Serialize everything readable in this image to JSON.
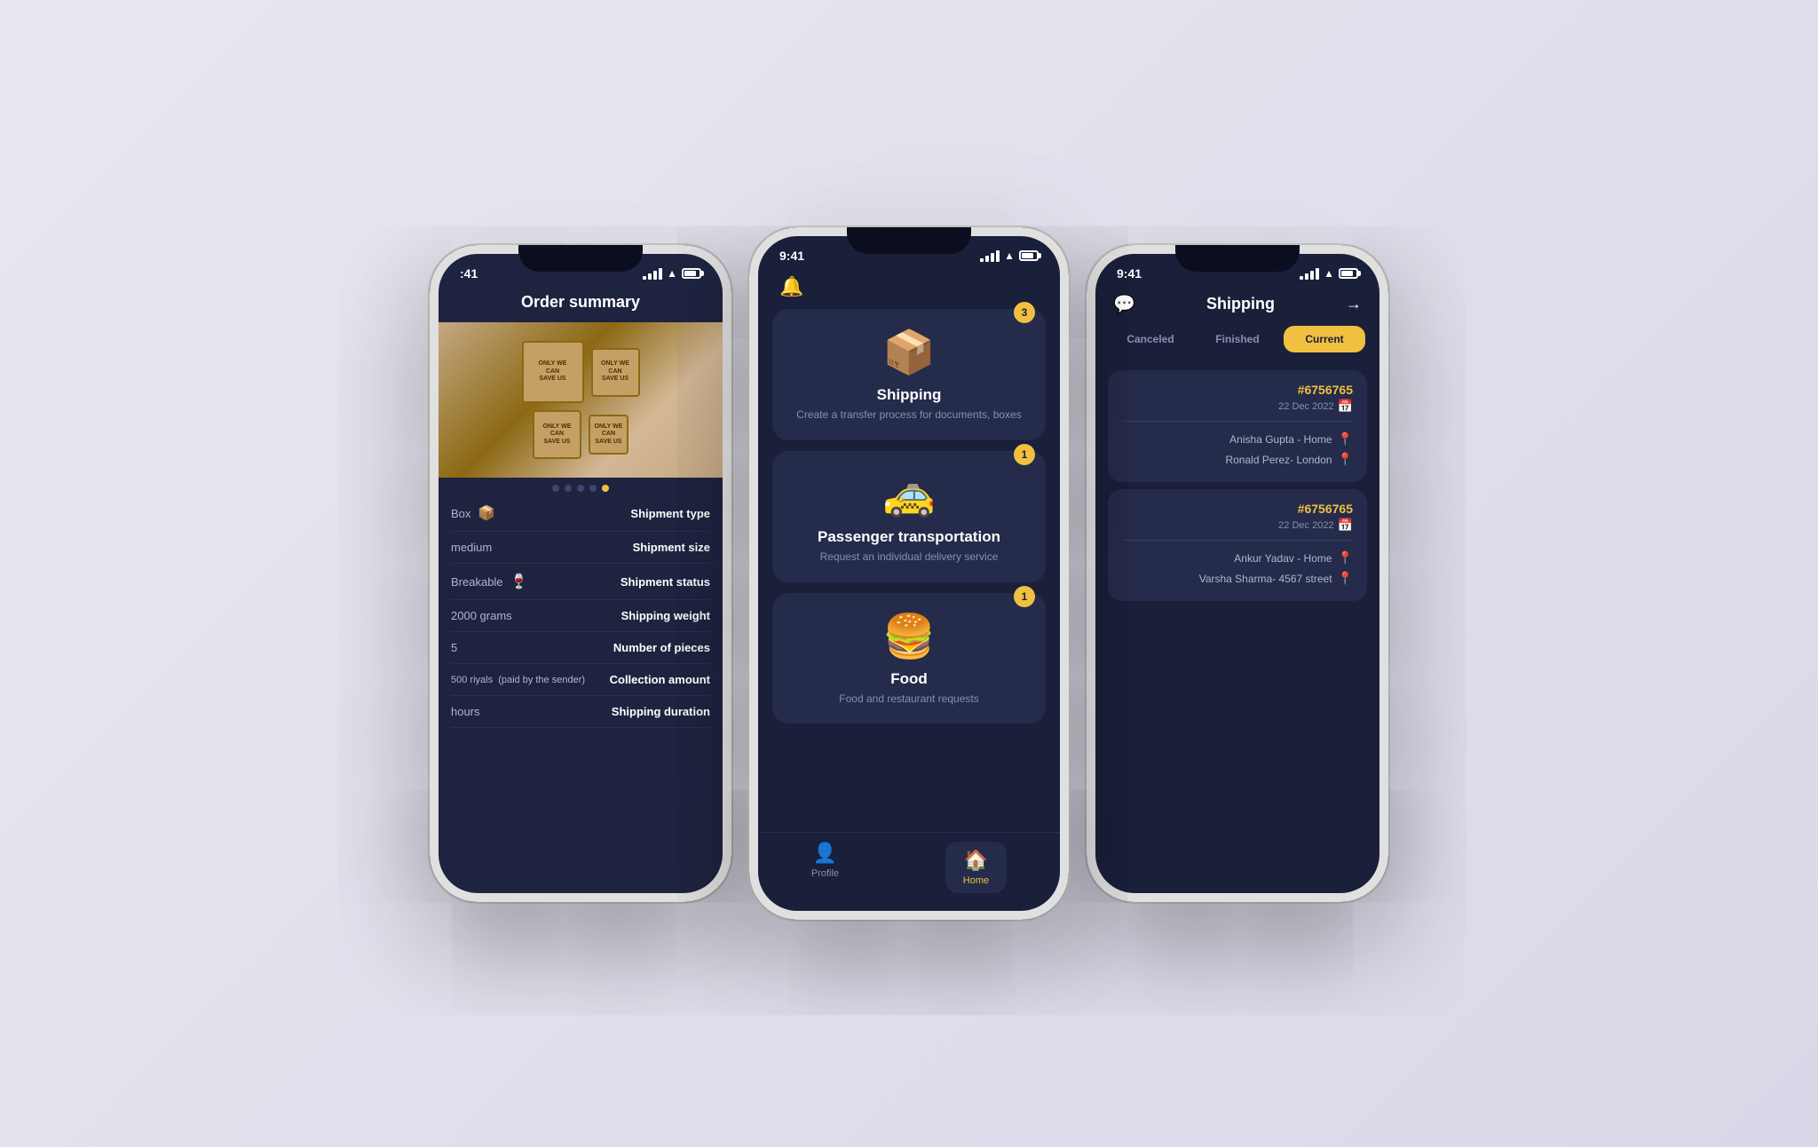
{
  "phone_left": {
    "status_time": ":41",
    "title": "Order summary",
    "dots": [
      false,
      false,
      false,
      false,
      true
    ],
    "rows": [
      {
        "value": "Box",
        "key": "Shipment type",
        "icon": "📦"
      },
      {
        "value": "medium",
        "key": "Shipment size",
        "icon": ""
      },
      {
        "value": "Breakable",
        "key": "Shipment status",
        "icon": "🍷"
      },
      {
        "value": "2000 grams",
        "key": "Shipping weight",
        "icon": ""
      },
      {
        "value": "5",
        "key": "Number of pieces",
        "icon": ""
      },
      {
        "value": "500 riyals  (paid by the sender)",
        "key": "Collection amount",
        "icon": ""
      },
      {
        "value": "hours",
        "key": "Shipping duration",
        "icon": ""
      }
    ]
  },
  "phone_center": {
    "status_time": "9:41",
    "services": [
      {
        "title": "Shipping",
        "desc": "Create a transfer process for documents, boxes",
        "icon": "📦",
        "badge": "3"
      },
      {
        "title": "Passenger transportation",
        "desc": "Request an individual delivery service",
        "icon": "🚕",
        "badge": "1"
      },
      {
        "title": "Food",
        "desc": "Food and restaurant requests",
        "icon": "🍔",
        "badge": "1"
      }
    ],
    "nav": [
      {
        "label": "Profile",
        "icon": "👤",
        "active": false
      },
      {
        "label": "Home",
        "icon": "🏠",
        "active": true
      }
    ]
  },
  "phone_right": {
    "status_time": "9:41",
    "title": "Shipping",
    "tabs": [
      {
        "label": "Canceled",
        "active": false
      },
      {
        "label": "Finished",
        "active": false
      },
      {
        "label": "Current",
        "active": true
      }
    ],
    "orders": [
      {
        "id": "#6756765",
        "date": "22 Dec 2022",
        "locations": [
          {
            "name": "Anisha Gupta  -  Home",
            "dot": "yellow"
          },
          {
            "name": "Ronald Perez- London",
            "dot": "orange"
          }
        ]
      },
      {
        "id": "#6756765",
        "date": "22 Dec 2022",
        "locations": [
          {
            "name": "Ankur Yadav   -  Home",
            "dot": "yellow"
          },
          {
            "name": "Varsha Sharma- 4567 street",
            "dot": "orange"
          }
        ]
      }
    ]
  }
}
